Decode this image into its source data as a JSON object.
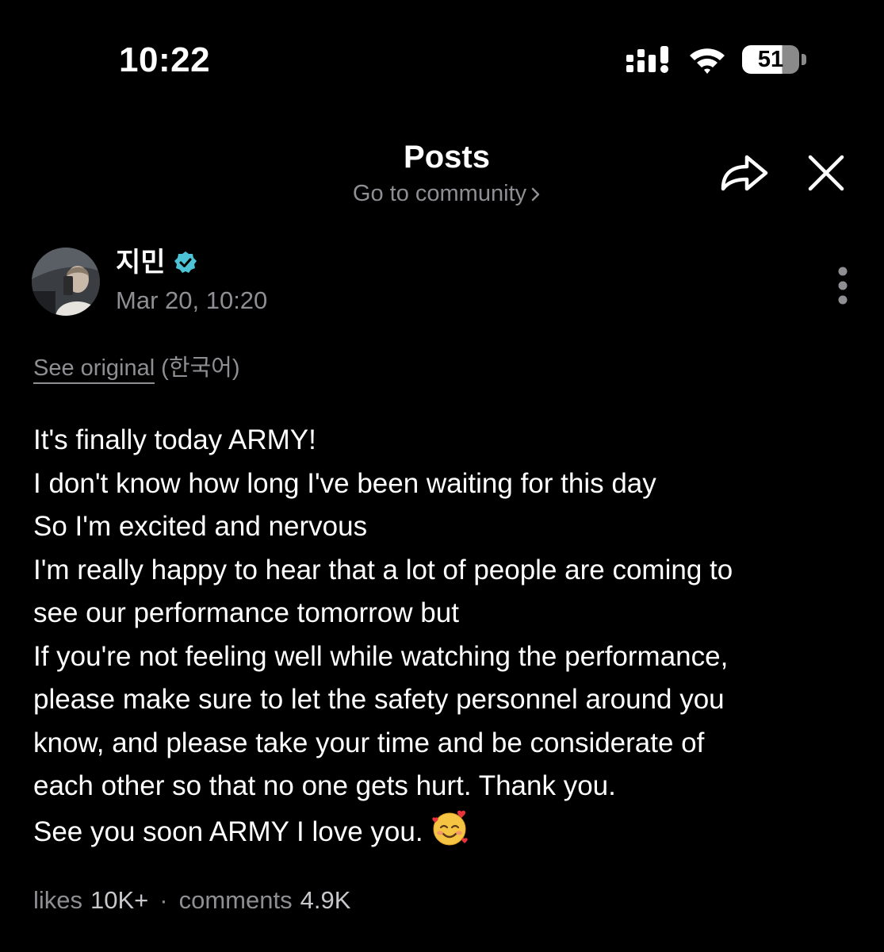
{
  "status_bar": {
    "time": "10:22",
    "battery": "51"
  },
  "header": {
    "title": "Posts",
    "subtitle": "Go to community"
  },
  "author": {
    "name": "지민",
    "date": "Mar 20, 10:20",
    "verified_color": "#4dc4d6"
  },
  "translation": {
    "link": "See original",
    "language": "(한국어)"
  },
  "post": {
    "lines": [
      "It's finally today ARMY!",
      "I don't know how long I've been waiting for this day",
      "So I'm excited and nervous",
      "I'm really happy to hear that a lot of people are coming to",
      "see our performance tomorrow but",
      "If you're not feeling well while watching the performance,",
      "please make sure to let the safety personnel around you",
      "know, and please take your time and be considerate of",
      "each other so that no one gets hurt. Thank you.",
      "See you soon ARMY I love you."
    ],
    "emoji": "smiling-face-with-hearts"
  },
  "stats": {
    "likes_label": "likes",
    "likes_value": "10K+",
    "separator": "·",
    "comments_label": "comments",
    "comments_value": "4.9K"
  },
  "colors": {
    "background": "#000000",
    "text": "#ffffff",
    "muted": "#8e8e93"
  },
  "icons": [
    "signal-icon",
    "wifi-icon",
    "battery-icon",
    "chevron-right-icon",
    "share-icon",
    "close-icon",
    "verified-icon",
    "more-vertical-icon"
  ]
}
